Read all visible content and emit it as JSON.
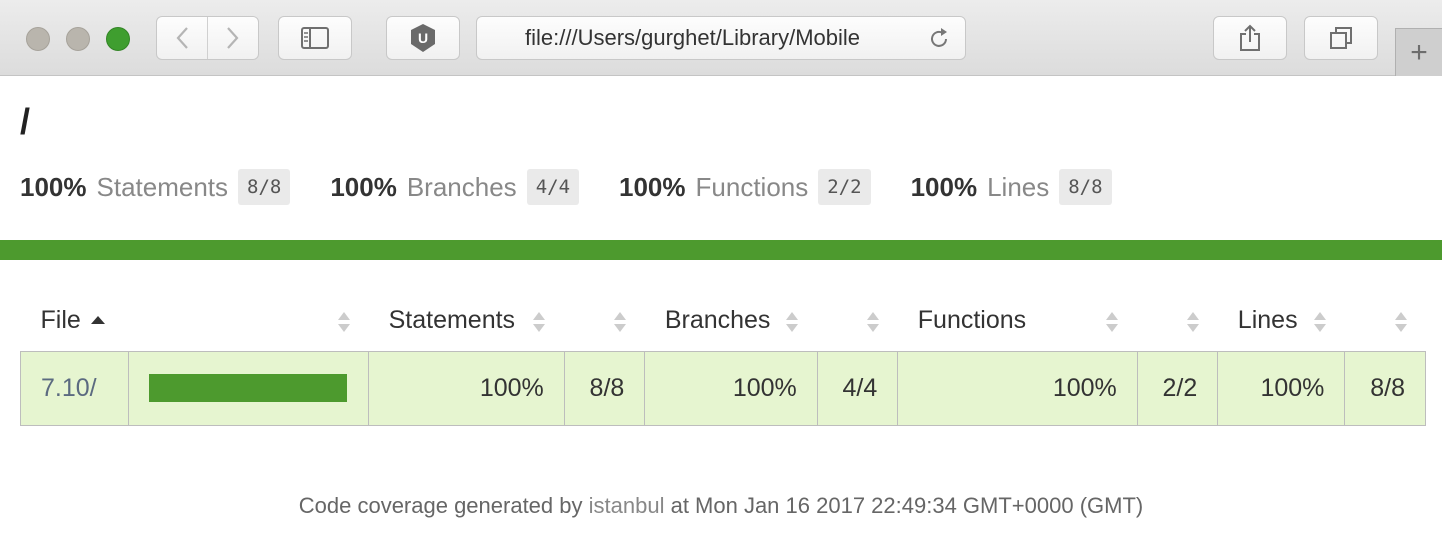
{
  "browser": {
    "url": "file:///Users/gurghet/Library/Mobile",
    "extension_letter": "U",
    "new_tab_label": "+"
  },
  "page": {
    "path": "/",
    "summary": [
      {
        "pct": "100%",
        "label": "Statements",
        "fraction": "8/8"
      },
      {
        "pct": "100%",
        "label": "Branches",
        "fraction": "4/4"
      },
      {
        "pct": "100%",
        "label": "Functions",
        "fraction": "2/2"
      },
      {
        "pct": "100%",
        "label": "Lines",
        "fraction": "8/8"
      }
    ],
    "status_color": "#4d9a2e"
  },
  "table": {
    "headers": {
      "file": "File",
      "statements": "Statements",
      "branches": "Branches",
      "functions": "Functions",
      "lines": "Lines"
    },
    "rows": [
      {
        "file": "7.10/",
        "coverage_fraction": 1.0,
        "statements_pct": "100%",
        "statements_frac": "8/8",
        "branches_pct": "100%",
        "branches_frac": "4/4",
        "functions_pct": "100%",
        "functions_frac": "2/2",
        "lines_pct": "100%",
        "lines_frac": "8/8"
      }
    ]
  },
  "footer": {
    "prefix": "Code coverage generated by ",
    "link": "istanbul",
    "suffix": " at Mon Jan 16 2017 22:49:34 GMT+0000 (GMT)"
  }
}
